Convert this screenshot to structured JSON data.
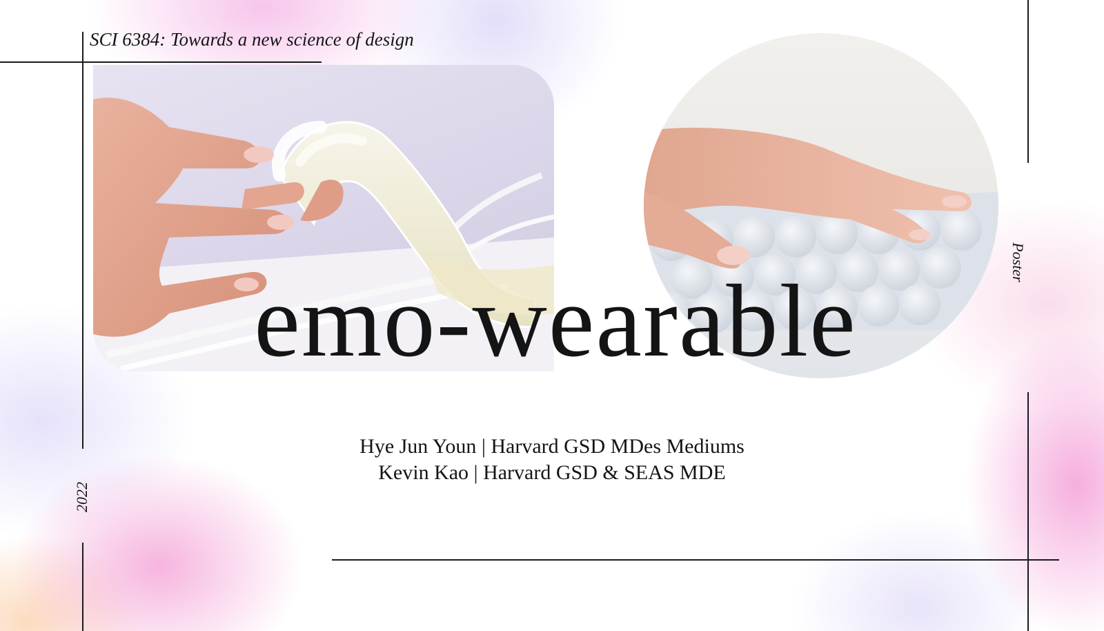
{
  "course": "SCI 6384: Towards a new science of design",
  "title": "emo-wearable",
  "authors": [
    "Hye Jun Youn | Harvard GSD MDes Mediums",
    "Kevin Kao | Harvard GSD & SEAS MDE"
  ],
  "side_label": "Poster",
  "year": "2022",
  "colors": {
    "accent_pink": "#f08cd2",
    "accent_lavender": "#cdc3f5",
    "accent_peach": "#fabe8c",
    "text": "#141414"
  },
  "images": {
    "left": "hand-holding-soft-silicone-actuator",
    "right": "hand-resting-on-inflated-bubble-pad"
  }
}
